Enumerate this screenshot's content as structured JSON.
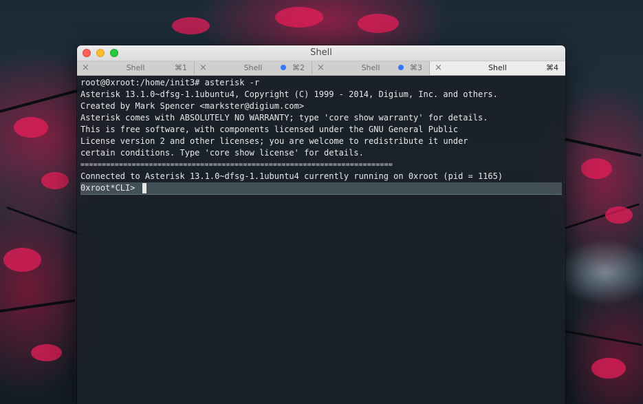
{
  "window": {
    "title": "Shell"
  },
  "tabs": [
    {
      "label": "Shell",
      "shortcut": "⌘1",
      "has_dot": false,
      "active": false
    },
    {
      "label": "Shell",
      "shortcut": "⌘2",
      "has_dot": true,
      "active": false
    },
    {
      "label": "Shell",
      "shortcut": "⌘3",
      "has_dot": true,
      "active": false
    },
    {
      "label": "Shell",
      "shortcut": "⌘4",
      "has_dot": false,
      "active": true
    }
  ],
  "icons": {
    "tab_close": "×"
  },
  "terminal": {
    "lines": [
      "root@0xroot:/home/init3# asterisk -r",
      "Asterisk 13.1.0~dfsg-1.1ubuntu4, Copyright (C) 1999 - 2014, Digium, Inc. and others.",
      "Created by Mark Spencer <markster@digium.com>",
      "Asterisk comes with ABSOLUTELY NO WARRANTY; type 'core show warranty' for details.",
      "This is free software, with components licensed under the GNU General Public",
      "License version 2 and other licenses; you are welcome to redistribute it under",
      "certain conditions. Type 'core show license' for details.",
      "=========================================================================",
      "Connected to Asterisk 13.1.0~dfsg-1.1ubuntu4 currently running on 0xroot (pid = 1165)"
    ],
    "prompt": "0xroot*CLI> "
  },
  "colors": {
    "dot_blue": "#3478f6",
    "close_red": "#fe5f57",
    "minimize_yellow": "#febc2e",
    "maximize_green": "#28c840"
  }
}
